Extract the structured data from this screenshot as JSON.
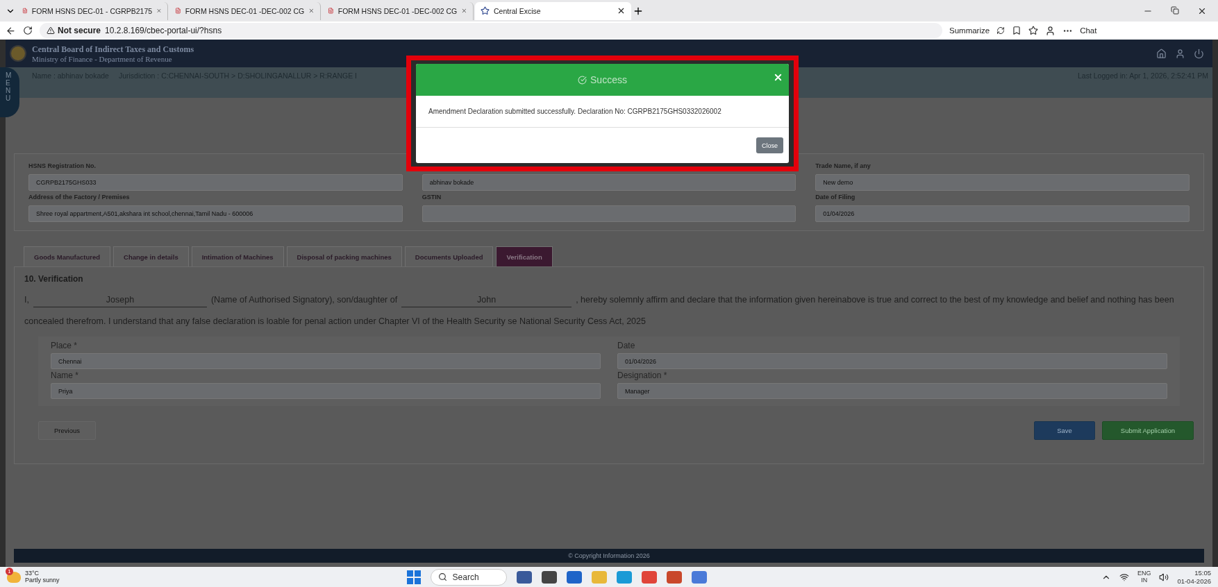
{
  "browser": {
    "tabs": [
      {
        "title": "FORM HSNS DEC-01 - CGRPB2175",
        "kind": "pdf",
        "selected": false
      },
      {
        "title": "FORM HSNS DEC-01 -DEC-002 CG",
        "kind": "pdf",
        "selected": false
      },
      {
        "title": "FORM HSNS DEC-01 -DEC-002 CG",
        "kind": "pdf",
        "selected": false
      },
      {
        "title": "Central Excise",
        "kind": "site",
        "selected": true
      }
    ],
    "security": "Not secure",
    "url": "10.2.8.169/cbec-portal-ui/?hsns",
    "summarize": "Summarize",
    "chat": "Chat"
  },
  "header": {
    "title": "Central Board of Indirect Taxes and Customs",
    "subtitle": "Ministry of Finance - Department of Revenue",
    "menu": "MENU"
  },
  "user_bar": {
    "name": "Name : abhinav bokade",
    "jurisdiction": "Jurisdiction : C:CHENNAI-SOUTH > D:SHOLINGANALLUR > R:RANGE I",
    "last_logged": "Last Logged in: Apr 1, 2026, 2:52:41 PM"
  },
  "details": [
    {
      "label": "HSNS Registration No.",
      "value": "CGRPB2175GHS033"
    },
    {
      "value": "abhinav bokade"
    },
    {
      "label": "Trade Name, if any",
      "value": "New demo"
    },
    {
      "label": "Address of the Factory / Premises",
      "value": "Shree royal appartment,A501,akshara int school,chennai,Tamil Nadu - 600006"
    },
    {
      "label": "GSTIN"
    },
    {
      "label": "Date of Filing",
      "value": "01/04/2026"
    }
  ],
  "tabs": [
    {
      "label": "Goods Manufactured",
      "selected": false
    },
    {
      "label": "Change in details",
      "selected": false
    },
    {
      "label": "Intimation of Machines",
      "selected": false
    },
    {
      "label": "Disposal of packing machines",
      "selected": false
    },
    {
      "label": "Documents Uploaded",
      "selected": false
    },
    {
      "label": "Verification",
      "selected": true
    }
  ],
  "verification": {
    "heading": "10. Verification",
    "prefix": "I,",
    "signatory": "Joseph",
    "middle": "(Name of Authorised Signatory), son/daughter of",
    "parent": "John",
    "rest": ", hereby solemnly affirm and declare that the information given hereinabove is true and correct to the best of my knowledge and belief and nothing has been concealed therefrom. I understand that any false declaration is loable for penal action under Chapter VI of the Health Security se National Security Cess Act, 2025",
    "fields": [
      {
        "label": "Place *",
        "value": "Chennai"
      },
      {
        "label": "Date",
        "value": "01/04/2026"
      },
      {
        "label": "Name *",
        "value": "Priya"
      },
      {
        "label": "Designation *",
        "value": "Manager"
      }
    ],
    "previous": "Previous",
    "save": "Save",
    "submit": "Submit Application"
  },
  "footer": "© Copyright Information 2026",
  "modal": {
    "title": "Success",
    "message": "Amendment Declaration submitted successfully. Declaration No: CGRPB2175GHS0332026002",
    "close": "Close"
  },
  "taskbar": {
    "badge": "1",
    "temperature": "33°C",
    "weather": "Partly sunny",
    "search": "Search",
    "lang": "ENG",
    "region": "IN",
    "time": "15:05",
    "date": "01-04-2026"
  }
}
